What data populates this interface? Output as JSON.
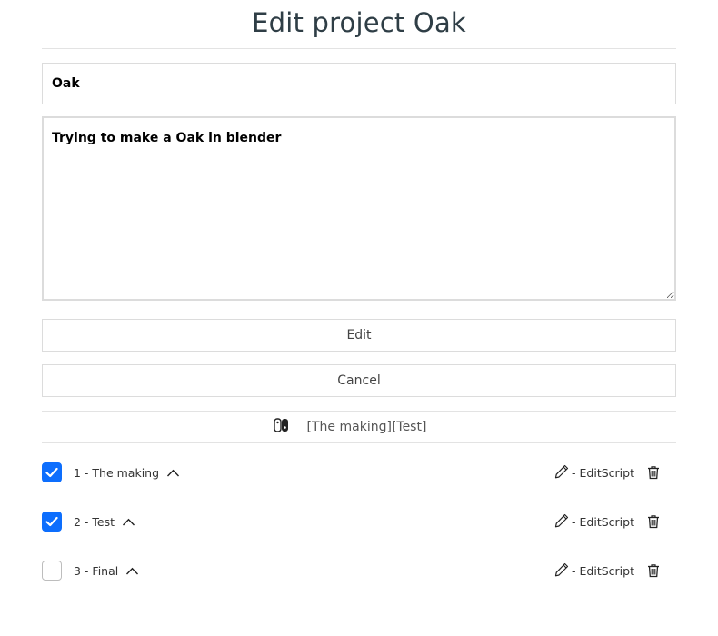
{
  "page": {
    "title": "Edit project Oak"
  },
  "form": {
    "name_value": "Oak",
    "description_value": "Trying to make a Oak in blender",
    "edit_label": "Edit",
    "cancel_label": "Cancel"
  },
  "tags": {
    "text": "[The making][Test]",
    "icon": "game-controller-icon"
  },
  "steps": [
    {
      "label": "1 - The making",
      "checked": true,
      "edit_label": "- EditScript"
    },
    {
      "label": "2 - Test",
      "checked": true,
      "edit_label": "- EditScript"
    },
    {
      "label": "3 - Final",
      "checked": false,
      "edit_label": "- EditScript"
    }
  ],
  "colors": {
    "accent": "#0d6efd",
    "border": "#dcdcdc",
    "title": "#2f3e46"
  }
}
